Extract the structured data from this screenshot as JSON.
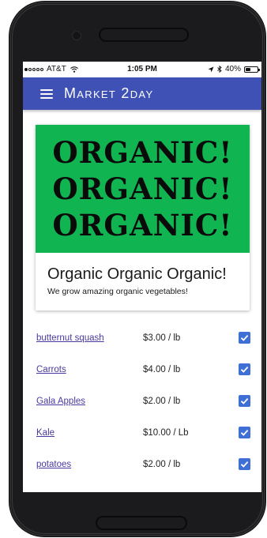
{
  "status_bar": {
    "carrier": "AT&T",
    "time": "1:05 PM",
    "battery": "40%",
    "battery_level": 0.4
  },
  "app_bar": {
    "title": "Market 2day"
  },
  "banner": {
    "lines": [
      "ORGANIC!",
      "ORGANIC!",
      "ORGANIC!"
    ],
    "color": "#10b551"
  },
  "card": {
    "title": "Organic Organic Organic!",
    "subtitle": "We grow amazing organic vegetables!"
  },
  "products": [
    {
      "name": "butternut squash",
      "price": "$3.00 / lb",
      "checked": true
    },
    {
      "name": "Carrots",
      "price": "$4.00 / lb",
      "checked": true
    },
    {
      "name": "Gala Apples",
      "price": "$2.00 / lb",
      "checked": true
    },
    {
      "name": "Kale",
      "price": "$10.00 / Lb",
      "checked": true
    },
    {
      "name": "potatoes",
      "price": "$2.00 / lb",
      "checked": true
    }
  ],
  "colors": {
    "app_bar": "#3f51b5",
    "checkbox": "#3f6fd6",
    "link": "#4a3a9e"
  }
}
